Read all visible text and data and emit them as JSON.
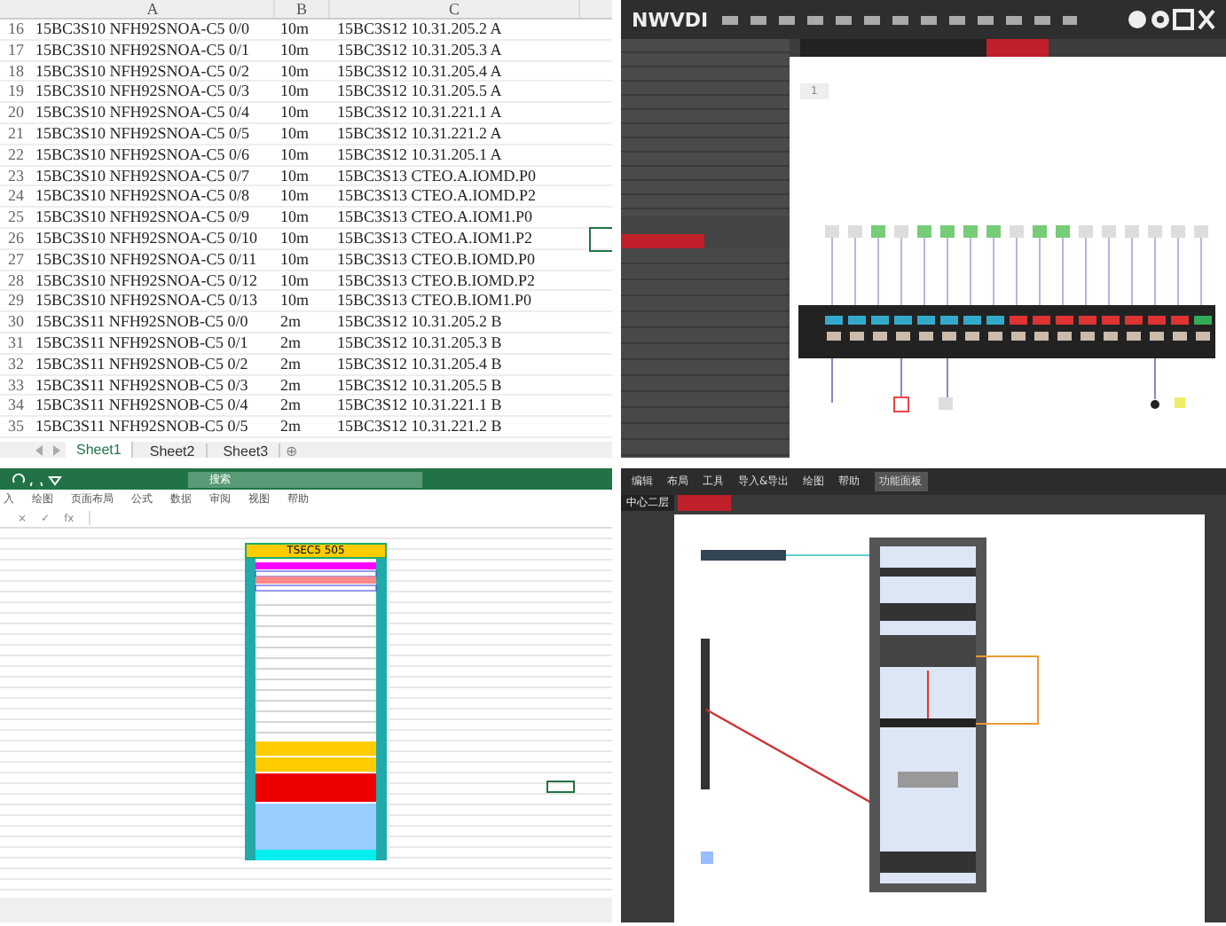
{
  "spreadsheet": {
    "columns": [
      "A",
      "B",
      "C"
    ],
    "rows": [
      {
        "num": "16",
        "cells": [
          "15BC3S10 NFH92SNOA-C5 0/0",
          "10m",
          "15BC3S12 10.31.205.2 A"
        ]
      },
      {
        "num": "17",
        "cells": [
          "15BC3S10 NFH92SNOA-C5 0/1",
          "10m",
          "15BC3S12 10.31.205.3 A"
        ]
      },
      {
        "num": "18",
        "cells": [
          "15BC3S10 NFH92SNOA-C5 0/2",
          "10m",
          "15BC3S12 10.31.205.4 A"
        ]
      },
      {
        "num": "19",
        "cells": [
          "15BC3S10 NFH92SNOA-C5 0/3",
          "10m",
          "15BC3S12 10.31.205.5 A"
        ]
      },
      {
        "num": "20",
        "cells": [
          "15BC3S10 NFH92SNOA-C5 0/4",
          "10m",
          "15BC3S12 10.31.221.1 A"
        ]
      },
      {
        "num": "21",
        "cells": [
          "15BC3S10 NFH92SNOA-C5 0/5",
          "10m",
          "15BC3S12 10.31.221.2 A"
        ]
      },
      {
        "num": "22",
        "cells": [
          "15BC3S10 NFH92SNOA-C5 0/6",
          "10m",
          "15BC3S12 10.31.205.1 A"
        ]
      },
      {
        "num": "23",
        "cells": [
          "15BC3S10 NFH92SNOA-C5 0/7",
          "10m",
          "15BC3S13 CTEO.A.IOMD.P0"
        ]
      },
      {
        "num": "24",
        "cells": [
          "15BC3S10 NFH92SNOA-C5 0/8",
          "10m",
          "15BC3S13 CTEO.A.IOMD.P2"
        ]
      },
      {
        "num": "25",
        "cells": [
          "15BC3S10 NFH92SNOA-C5 0/9",
          "10m",
          "15BC3S13 CTEO.A.IOM1.P0"
        ]
      },
      {
        "num": "26",
        "cells": [
          "15BC3S10 NFH92SNOA-C5 0/10",
          "10m",
          "15BC3S13 CTEO.A.IOM1.P2"
        ]
      },
      {
        "num": "27",
        "cells": [
          "15BC3S10 NFH92SNOA-C5 0/11",
          "10m",
          "15BC3S13 CTEO.B.IOMD.P0"
        ]
      },
      {
        "num": "28",
        "cells": [
          "15BC3S10 NFH92SNOA-C5 0/12",
          "10m",
          "15BC3S13 CTEO.B.IOMD.P2"
        ]
      },
      {
        "num": "29",
        "cells": [
          "15BC3S10 NFH92SNOA-C5 0/13",
          "10m",
          "15BC3S13 CTEO.B.IOM1.P0"
        ]
      },
      {
        "num": "30",
        "cells": [
          "15BC3S11 NFH92SNOB-C5 0/0",
          "2m",
          "15BC3S12 10.31.205.2 B"
        ]
      },
      {
        "num": "31",
        "cells": [
          "15BC3S11 NFH92SNOB-C5 0/1",
          "2m",
          "15BC3S12 10.31.205.3 B"
        ]
      },
      {
        "num": "32",
        "cells": [
          "15BC3S11 NFH92SNOB-C5 0/2",
          "2m",
          "15BC3S12 10.31.205.4 B"
        ]
      },
      {
        "num": "33",
        "cells": [
          "15BC3S11 NFH92SNOB-C5 0/3",
          "2m",
          "15BC3S12 10.31.205.5 B"
        ]
      },
      {
        "num": "34",
        "cells": [
          "15BC3S11 NFH92SNOB-C5 0/4",
          "2m",
          "15BC3S12 10.31.221.1 B"
        ]
      },
      {
        "num": "35",
        "cells": [
          "15BC3S11 NFH92SNOB-C5 0/5",
          "2m",
          "15BC3S12 10.31.221.2 B"
        ]
      }
    ],
    "sheets": [
      {
        "label": "Sheet1",
        "selected": true
      },
      {
        "label": "Sheet2",
        "selected": false
      },
      {
        "label": "Sheet3",
        "selected": false
      }
    ],
    "add_sheet": "⊕"
  },
  "nwvdi": {
    "logo": "NWVDI",
    "canvas_tab": "1"
  },
  "excel": {
    "search_placeholder": "搜索",
    "ribbon_tabs": [
      "入",
      "绘图",
      "页面布局",
      "公式",
      "数据",
      "审阅",
      "视图",
      "帮助"
    ],
    "formula_icons": [
      "×",
      "✓",
      "fx"
    ],
    "rack_title": "TSEC5 505"
  },
  "rack_view": {
    "menu": [
      {
        "label": "编辑",
        "selected": false
      },
      {
        "label": "布局",
        "selected": false
      },
      {
        "label": "工具",
        "selected": false
      },
      {
        "label": "导入&导出",
        "selected": false
      },
      {
        "label": "绘图",
        "selected": false
      },
      {
        "label": "帮助",
        "selected": false
      },
      {
        "label": "功能面板",
        "selected": true
      }
    ],
    "location": "中心二层"
  }
}
